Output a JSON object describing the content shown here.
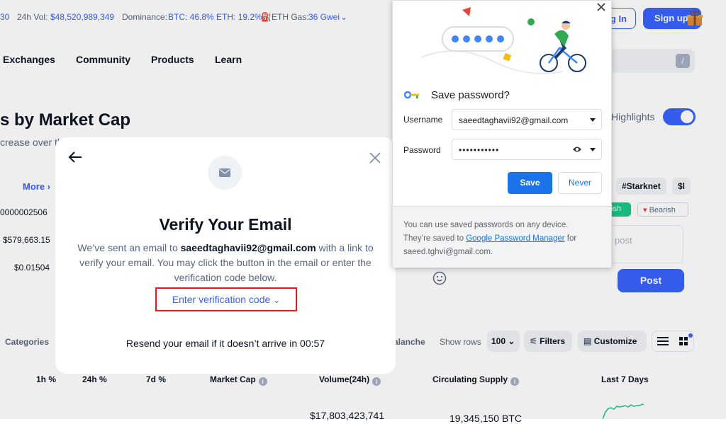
{
  "stats": {
    "cryptos_partial": "30",
    "vol_label": "24h Vol:",
    "vol_value": "$48,520,989,349",
    "dominance_label": "Dominance:",
    "dominance_value": "BTC: 46.8% ETH: 19.2%",
    "gas_label": "ETH Gas:",
    "gas_value": "36 Gwei"
  },
  "header": {
    "login_partial": "g In",
    "signup": "Sign up",
    "search_key": "/"
  },
  "nav": [
    "Exchanges",
    "Community",
    "Products",
    "Learn"
  ],
  "page": {
    "headline_partial": "s by Market Cap",
    "subline_partial": "crease over th",
    "highlights": "Highlights"
  },
  "left_card": {
    "more": "More",
    "prices": [
      "0000002506",
      "$579,663.15",
      "$0.01504"
    ]
  },
  "community": {
    "tags": [
      "#Starknet",
      "$l"
    ],
    "bullish_partial": "ish",
    "bearish": "Bearish",
    "post_placeholder": "post",
    "post_button": "Post"
  },
  "toolbar": {
    "categories": "Categories",
    "avalanche_partial": "alanche",
    "show_rows_label": "Show rows",
    "rows_value": "100",
    "filters": "Filters",
    "customize": "Customize"
  },
  "table": {
    "headers": [
      "1h %",
      "24h %",
      "7d %",
      "Market Cap",
      "Volume(24h)",
      "Circulating Supply",
      "Last 7 Days"
    ],
    "row_partial": {
      "volume": "$17,803,423,741",
      "supply": "19,345,150 BTC"
    }
  },
  "modal": {
    "title": "Verify Your Email",
    "desc_before": "We’ve sent an email to ",
    "email": "saeedtaghavii92@gmail.com",
    "desc_after": " with a link to verify your email. You may click the button in the email or enter the verification code below.",
    "enter_code": "Enter verification code",
    "resend": "Resend your email if it doesn’t arrive in 00:57"
  },
  "password_popup": {
    "title": "Save password?",
    "username_label": "Username",
    "username_value": "saeedtaghavii92@gmail.com",
    "password_label": "Password",
    "password_value": "•••••••••••",
    "save": "Save",
    "never": "Never",
    "footer_before": "You can use saved passwords on any device. They’re saved to ",
    "footer_link": "Google Password Manager",
    "footer_after": " for saeed.tghvi@gmail.com."
  },
  "colors": {
    "accent": "#3861fb",
    "chrome_blue": "#1a73e8",
    "highlight_red": "#e21b1b"
  }
}
